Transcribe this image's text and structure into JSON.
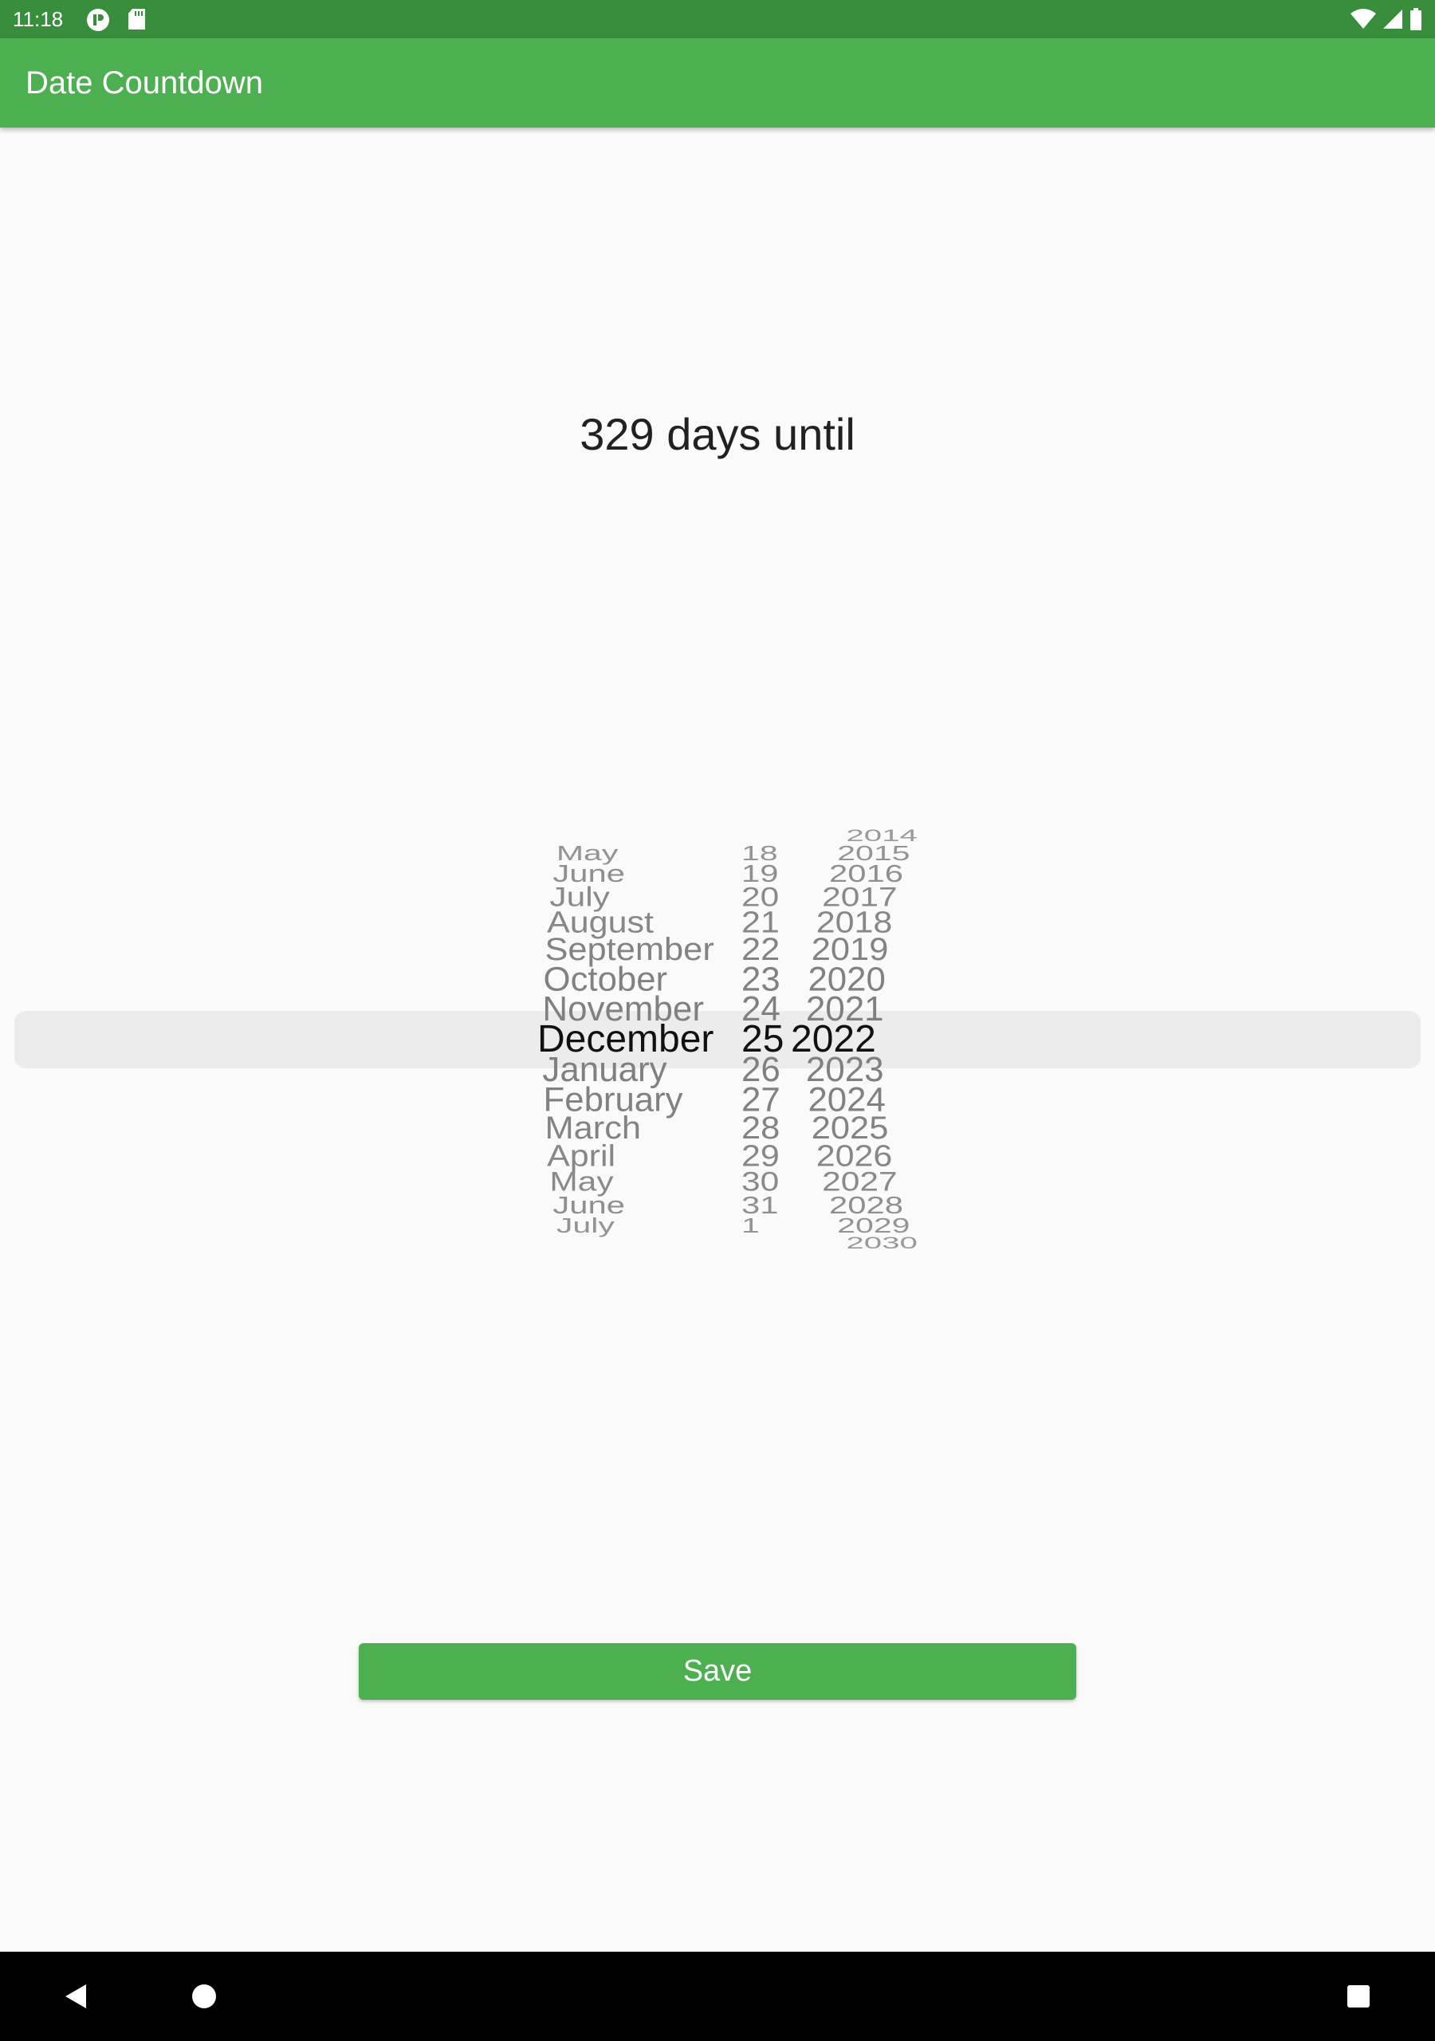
{
  "status_bar": {
    "time": "11:18",
    "icons": [
      "app-notification-icon",
      "sd-card-icon",
      "wifi-icon",
      "signal-icon",
      "battery-icon"
    ]
  },
  "app_bar": {
    "title": "Date Countdown"
  },
  "countdown": {
    "text": "329 days until"
  },
  "picker": {
    "months": {
      "items": [
        "May",
        "June",
        "July",
        "August",
        "September",
        "October",
        "November",
        "December",
        "January",
        "February",
        "March",
        "April",
        "May",
        "June",
        "July"
      ],
      "selected": "December"
    },
    "days": {
      "items": [
        "18",
        "19",
        "20",
        "21",
        "22",
        "23",
        "24",
        "25",
        "26",
        "27",
        "28",
        "29",
        "30",
        "31",
        "1"
      ],
      "selected": "25"
    },
    "years": {
      "items": [
        "2014",
        "2015",
        "2016",
        "2017",
        "2018",
        "2019",
        "2020",
        "2021",
        "2022",
        "2023",
        "2024",
        "2025",
        "2026",
        "2027",
        "2028",
        "2029",
        "2030"
      ],
      "selected": "2022"
    }
  },
  "save_button": {
    "label": "Save"
  },
  "nav_bar": {
    "buttons": [
      "back-icon",
      "home-icon",
      "recents-icon"
    ]
  },
  "colors": {
    "status_bar": "#388e3c",
    "primary": "#4caf50",
    "background": "#fafafa",
    "picker_highlight": "#ececec",
    "nav_bar": "#000000"
  }
}
